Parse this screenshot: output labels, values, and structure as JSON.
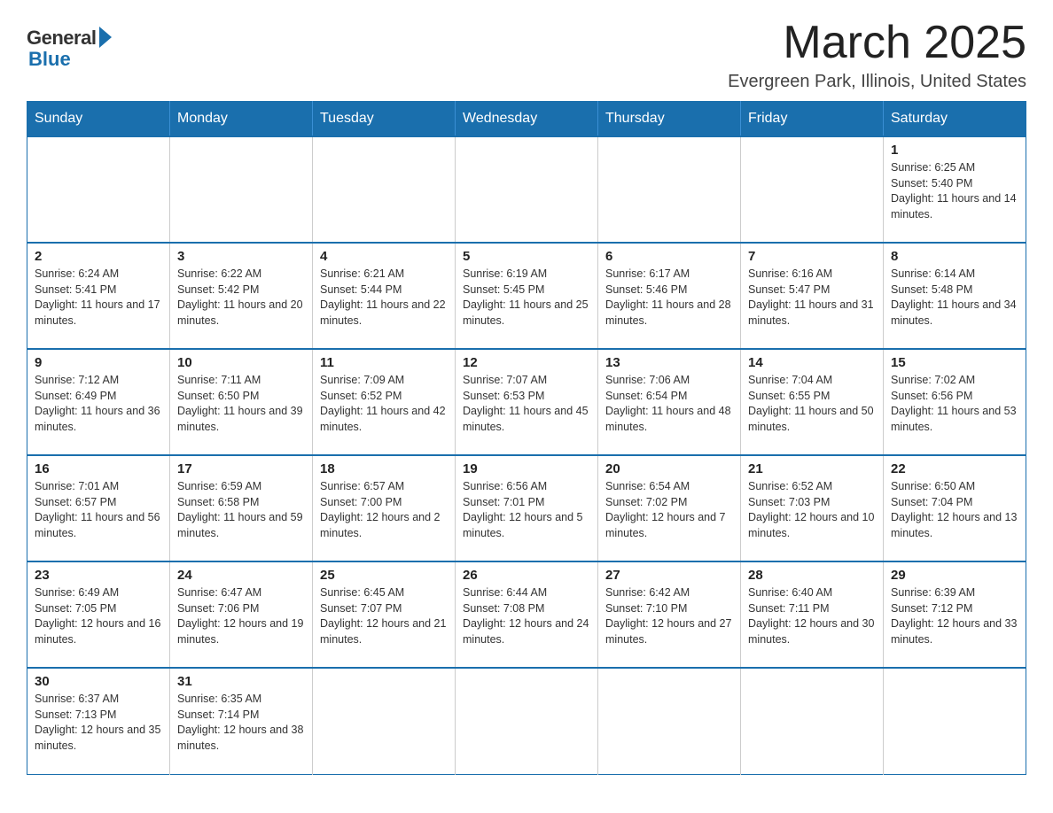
{
  "header": {
    "logo_general": "General",
    "logo_blue": "Blue",
    "month_title": "March 2025",
    "location": "Evergreen Park, Illinois, United States"
  },
  "days_of_week": [
    "Sunday",
    "Monday",
    "Tuesday",
    "Wednesday",
    "Thursday",
    "Friday",
    "Saturday"
  ],
  "weeks": [
    [
      {
        "day": "",
        "info": ""
      },
      {
        "day": "",
        "info": ""
      },
      {
        "day": "",
        "info": ""
      },
      {
        "day": "",
        "info": ""
      },
      {
        "day": "",
        "info": ""
      },
      {
        "day": "",
        "info": ""
      },
      {
        "day": "1",
        "info": "Sunrise: 6:25 AM\nSunset: 5:40 PM\nDaylight: 11 hours and 14 minutes."
      }
    ],
    [
      {
        "day": "2",
        "info": "Sunrise: 6:24 AM\nSunset: 5:41 PM\nDaylight: 11 hours and 17 minutes."
      },
      {
        "day": "3",
        "info": "Sunrise: 6:22 AM\nSunset: 5:42 PM\nDaylight: 11 hours and 20 minutes."
      },
      {
        "day": "4",
        "info": "Sunrise: 6:21 AM\nSunset: 5:44 PM\nDaylight: 11 hours and 22 minutes."
      },
      {
        "day": "5",
        "info": "Sunrise: 6:19 AM\nSunset: 5:45 PM\nDaylight: 11 hours and 25 minutes."
      },
      {
        "day": "6",
        "info": "Sunrise: 6:17 AM\nSunset: 5:46 PM\nDaylight: 11 hours and 28 minutes."
      },
      {
        "day": "7",
        "info": "Sunrise: 6:16 AM\nSunset: 5:47 PM\nDaylight: 11 hours and 31 minutes."
      },
      {
        "day": "8",
        "info": "Sunrise: 6:14 AM\nSunset: 5:48 PM\nDaylight: 11 hours and 34 minutes."
      }
    ],
    [
      {
        "day": "9",
        "info": "Sunrise: 7:12 AM\nSunset: 6:49 PM\nDaylight: 11 hours and 36 minutes."
      },
      {
        "day": "10",
        "info": "Sunrise: 7:11 AM\nSunset: 6:50 PM\nDaylight: 11 hours and 39 minutes."
      },
      {
        "day": "11",
        "info": "Sunrise: 7:09 AM\nSunset: 6:52 PM\nDaylight: 11 hours and 42 minutes."
      },
      {
        "day": "12",
        "info": "Sunrise: 7:07 AM\nSunset: 6:53 PM\nDaylight: 11 hours and 45 minutes."
      },
      {
        "day": "13",
        "info": "Sunrise: 7:06 AM\nSunset: 6:54 PM\nDaylight: 11 hours and 48 minutes."
      },
      {
        "day": "14",
        "info": "Sunrise: 7:04 AM\nSunset: 6:55 PM\nDaylight: 11 hours and 50 minutes."
      },
      {
        "day": "15",
        "info": "Sunrise: 7:02 AM\nSunset: 6:56 PM\nDaylight: 11 hours and 53 minutes."
      }
    ],
    [
      {
        "day": "16",
        "info": "Sunrise: 7:01 AM\nSunset: 6:57 PM\nDaylight: 11 hours and 56 minutes."
      },
      {
        "day": "17",
        "info": "Sunrise: 6:59 AM\nSunset: 6:58 PM\nDaylight: 11 hours and 59 minutes."
      },
      {
        "day": "18",
        "info": "Sunrise: 6:57 AM\nSunset: 7:00 PM\nDaylight: 12 hours and 2 minutes."
      },
      {
        "day": "19",
        "info": "Sunrise: 6:56 AM\nSunset: 7:01 PM\nDaylight: 12 hours and 5 minutes."
      },
      {
        "day": "20",
        "info": "Sunrise: 6:54 AM\nSunset: 7:02 PM\nDaylight: 12 hours and 7 minutes."
      },
      {
        "day": "21",
        "info": "Sunrise: 6:52 AM\nSunset: 7:03 PM\nDaylight: 12 hours and 10 minutes."
      },
      {
        "day": "22",
        "info": "Sunrise: 6:50 AM\nSunset: 7:04 PM\nDaylight: 12 hours and 13 minutes."
      }
    ],
    [
      {
        "day": "23",
        "info": "Sunrise: 6:49 AM\nSunset: 7:05 PM\nDaylight: 12 hours and 16 minutes."
      },
      {
        "day": "24",
        "info": "Sunrise: 6:47 AM\nSunset: 7:06 PM\nDaylight: 12 hours and 19 minutes."
      },
      {
        "day": "25",
        "info": "Sunrise: 6:45 AM\nSunset: 7:07 PM\nDaylight: 12 hours and 21 minutes."
      },
      {
        "day": "26",
        "info": "Sunrise: 6:44 AM\nSunset: 7:08 PM\nDaylight: 12 hours and 24 minutes."
      },
      {
        "day": "27",
        "info": "Sunrise: 6:42 AM\nSunset: 7:10 PM\nDaylight: 12 hours and 27 minutes."
      },
      {
        "day": "28",
        "info": "Sunrise: 6:40 AM\nSunset: 7:11 PM\nDaylight: 12 hours and 30 minutes."
      },
      {
        "day": "29",
        "info": "Sunrise: 6:39 AM\nSunset: 7:12 PM\nDaylight: 12 hours and 33 minutes."
      }
    ],
    [
      {
        "day": "30",
        "info": "Sunrise: 6:37 AM\nSunset: 7:13 PM\nDaylight: 12 hours and 35 minutes."
      },
      {
        "day": "31",
        "info": "Sunrise: 6:35 AM\nSunset: 7:14 PM\nDaylight: 12 hours and 38 minutes."
      },
      {
        "day": "",
        "info": ""
      },
      {
        "day": "",
        "info": ""
      },
      {
        "day": "",
        "info": ""
      },
      {
        "day": "",
        "info": ""
      },
      {
        "day": "",
        "info": ""
      }
    ]
  ]
}
